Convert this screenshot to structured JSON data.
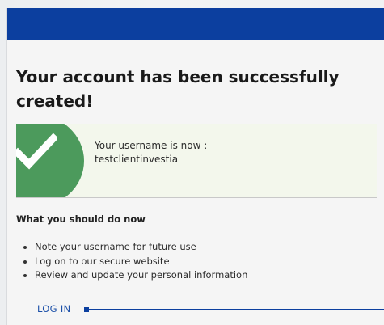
{
  "header": {
    "bar_color": "#0c3f9f"
  },
  "confirmation": {
    "title": "Your account has been successfully created!",
    "icon": "checkmark-icon",
    "icon_color": "#4c9a5c",
    "username_label": "Your username is now :",
    "username_value": "testclientinvestia"
  },
  "next_steps": {
    "heading": "What you should do now",
    "items": [
      "Note your username for future use",
      "Log on to our secure website",
      "Review and update your personal information"
    ]
  },
  "actions": {
    "login_label": "LOG IN"
  }
}
